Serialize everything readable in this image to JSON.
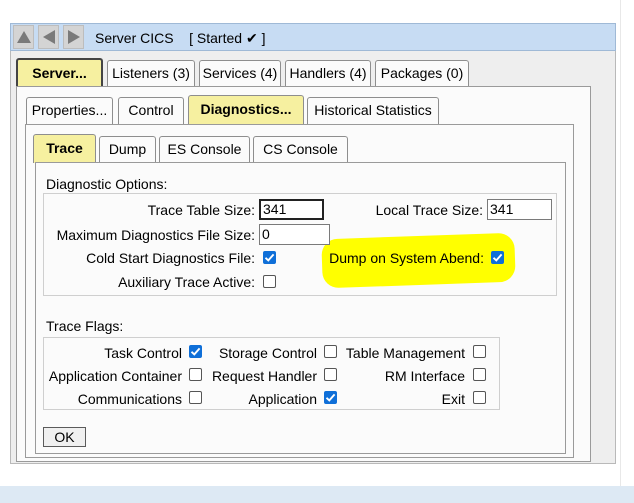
{
  "window": {
    "title": "Server CICS",
    "status": "[ Started",
    "status_mark": "✔",
    "status_end": "]",
    "nav": [
      "up-icon",
      "back-icon",
      "forward-icon"
    ]
  },
  "top_tabs": [
    {
      "label": "Server...",
      "active": true
    },
    {
      "label": "Listeners (3)",
      "active": false
    },
    {
      "label": "Services (4)",
      "active": false
    },
    {
      "label": "Handlers (4)",
      "active": false
    },
    {
      "label": "Packages (0)",
      "active": false
    }
  ],
  "server_tabs": [
    {
      "label": "Properties...",
      "active": false
    },
    {
      "label": "Control",
      "active": false
    },
    {
      "label": "Diagnostics...",
      "active": true
    },
    {
      "label": "Historical Statistics",
      "active": false
    }
  ],
  "diag_tabs": [
    {
      "label": "Trace",
      "active": true
    },
    {
      "label": "Dump",
      "active": false
    },
    {
      "label": "ES Console",
      "active": false
    },
    {
      "label": "CS Console",
      "active": false
    }
  ],
  "diagnostic_options": {
    "heading": "Diagnostic Options:",
    "trace_table_size_label": "Trace Table Size:",
    "trace_table_size_value": "341",
    "local_trace_size_label": "Local Trace Size:",
    "local_trace_size_value": "341",
    "max_diag_file_size_label": "Maximum Diagnostics File Size:",
    "max_diag_file_size_value": "0",
    "cold_start_label": "Cold Start Diagnostics File:",
    "cold_start_checked": true,
    "dump_on_abend_label": "Dump on System Abend:",
    "dump_on_abend_checked": true,
    "aux_trace_label": "Auxiliary Trace Active:",
    "aux_trace_checked": false
  },
  "trace_flags": {
    "heading": "Trace Flags:",
    "items": [
      {
        "label": "Task Control",
        "checked": true
      },
      {
        "label": "Storage Control",
        "checked": false
      },
      {
        "label": "Table Management",
        "checked": false
      },
      {
        "label": "Application Container",
        "checked": false
      },
      {
        "label": "Request Handler",
        "checked": false
      },
      {
        "label": "RM Interface",
        "checked": false
      },
      {
        "label": "Communications",
        "checked": false
      },
      {
        "label": "Application",
        "checked": true
      },
      {
        "label": "Exit",
        "checked": false
      }
    ]
  },
  "ok_label": "OK",
  "colors": {
    "title_bar": "#c7dcf3",
    "active_tab": "#f6f0a0",
    "highlight": "#ffff00",
    "checkbox_checked": "#0f6fd8"
  }
}
